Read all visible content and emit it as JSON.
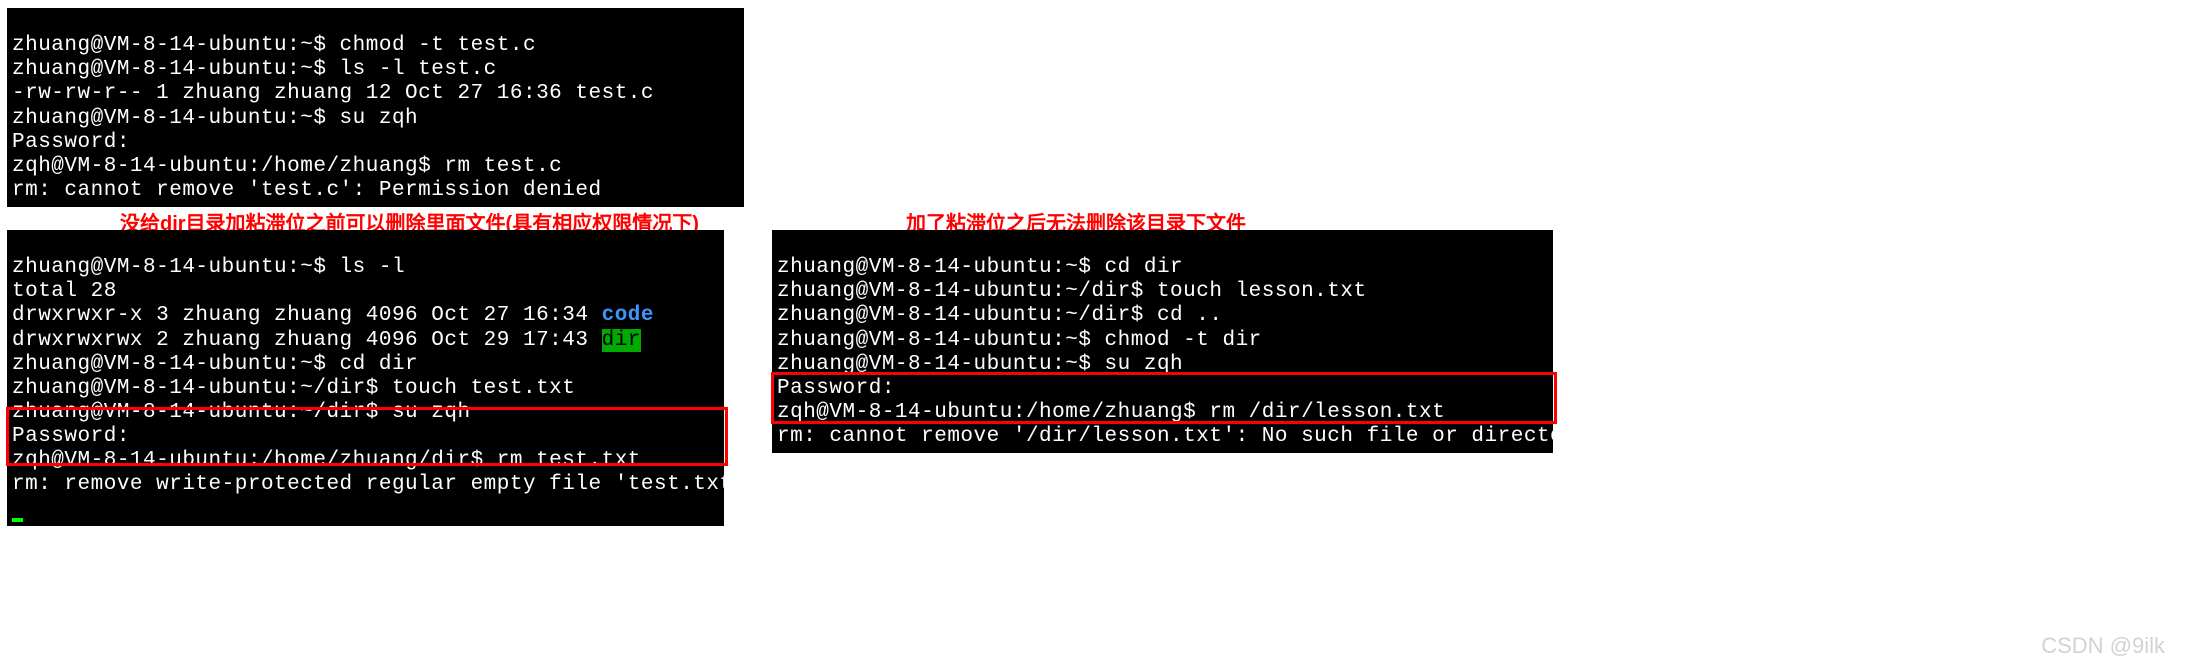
{
  "top_terminal": {
    "lines": [
      "zhuang@VM-8-14-ubuntu:~$ chmod -t test.c",
      "zhuang@VM-8-14-ubuntu:~$ ls -l test.c",
      "-rw-rw-r-- 1 zhuang zhuang 12 Oct 27 16:36 test.c",
      "zhuang@VM-8-14-ubuntu:~$ su zqh",
      "Password:",
      "zqh@VM-8-14-ubuntu:/home/zhuang$ rm test.c",
      "rm: cannot remove 'test.c': Permission denied"
    ]
  },
  "captions": {
    "left": "没给dir目录加粘滞位之前可以删除里面文件(具有相应权限情况下)",
    "right": "加了粘滞位之后无法删除该目录下文件"
  },
  "left_terminal": {
    "line0": "zhuang@VM-8-14-ubuntu:~$ ls -l",
    "line1": "total 28",
    "line2_prefix": "drwxrwxr-x 3 zhuang zhuang 4096 Oct 27 16:34 ",
    "line2_code": "code",
    "line3_prefix": "drwxrwxrwx 2 zhuang zhuang 4096 Oct 29 17:43 ",
    "line3_dir": "dir",
    "line4": "zhuang@VM-8-14-ubuntu:~$ cd dir",
    "line5": "zhuang@VM-8-14-ubuntu:~/dir$ touch test.txt",
    "line6": "zhuang@VM-8-14-ubuntu:~/dir$ su zqh",
    "line7": "Password:",
    "line8": "zqh@VM-8-14-ubuntu:/home/zhuang/dir$ rm test.txt",
    "line9": "rm: remove write-protected regular empty file 'test.txt'? y"
  },
  "right_terminal": {
    "lines": [
      "zhuang@VM-8-14-ubuntu:~$ cd dir",
      "zhuang@VM-8-14-ubuntu:~/dir$ touch lesson.txt",
      "zhuang@VM-8-14-ubuntu:~/dir$ cd ..",
      "zhuang@VM-8-14-ubuntu:~$ chmod -t dir",
      "zhuang@VM-8-14-ubuntu:~$ su zqh",
      "Password:",
      "zqh@VM-8-14-ubuntu:/home/zhuang$ rm /dir/lesson.txt",
      "rm: cannot remove '/dir/lesson.txt': No such file or directory"
    ]
  },
  "watermark": "CSDN @9ilk"
}
